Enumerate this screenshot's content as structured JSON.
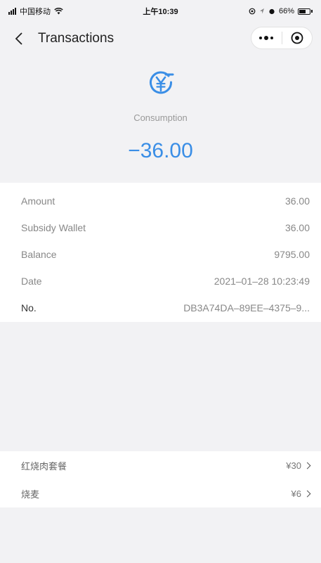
{
  "status_bar": {
    "carrier": "中国移动",
    "time": "上午10:39",
    "battery": "66%"
  },
  "nav": {
    "title": "Transactions"
  },
  "header": {
    "icon": "yen-circle-icon",
    "type_label": "Consumption",
    "amount": "−36.00",
    "accent_color": "#3a8ee6"
  },
  "details": [
    {
      "label": "Amount",
      "value": "36.00"
    },
    {
      "label": "Subsidy Wallet",
      "value": "36.00"
    },
    {
      "label": "Balance",
      "value": "9795.00"
    },
    {
      "label": "Date",
      "value": "2021–01–28 10:23:49"
    },
    {
      "label": "No.",
      "value": "DB3A74DA–89EE–4375–9..."
    }
  ],
  "items": [
    {
      "name": "红烧肉套餐",
      "price": "¥30"
    },
    {
      "name": "烧麦",
      "price": "¥6"
    }
  ]
}
